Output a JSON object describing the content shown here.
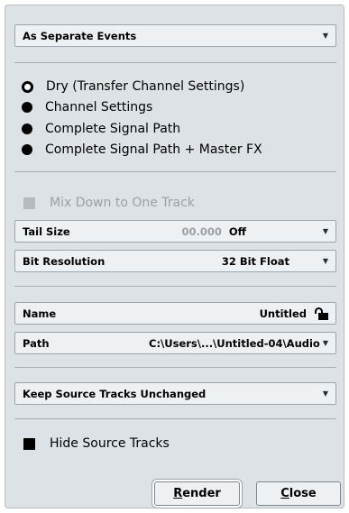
{
  "event_mode": {
    "value": "As Separate Events"
  },
  "source_options": [
    {
      "label": "Dry (Transfer Channel Settings)",
      "selected": true
    },
    {
      "label": "Channel Settings",
      "selected": false
    },
    {
      "label": "Complete Signal Path",
      "selected": false
    },
    {
      "label": "Complete Signal Path + Master FX",
      "selected": false
    }
  ],
  "mix_down": {
    "label": "Mix Down to One Track",
    "enabled": false
  },
  "tail_size": {
    "label": "Tail Size",
    "time": "00.000",
    "value": "Off"
  },
  "bit_resolution": {
    "label": "Bit Resolution",
    "value": "32 Bit Float"
  },
  "name": {
    "label": "Name",
    "value": "Untitled",
    "icon": "lock-icon"
  },
  "path": {
    "label": "Path",
    "value": "C:\\Users\\...\\Untitled-04\\Audio"
  },
  "source_tracks": {
    "value": "Keep Source Tracks Unchanged"
  },
  "hide_source": {
    "label": "Hide Source Tracks",
    "checked": true
  },
  "buttons": {
    "render_prefix": "",
    "render_mnemonic": "R",
    "render_rest": "ender",
    "close_prefix": "",
    "close_mnemonic": "C",
    "close_rest": "lose"
  },
  "icons": {
    "dropdown": "chevron-down-icon"
  },
  "colors": {
    "panel": "#dde2e6",
    "field": "#eef1f3"
  }
}
